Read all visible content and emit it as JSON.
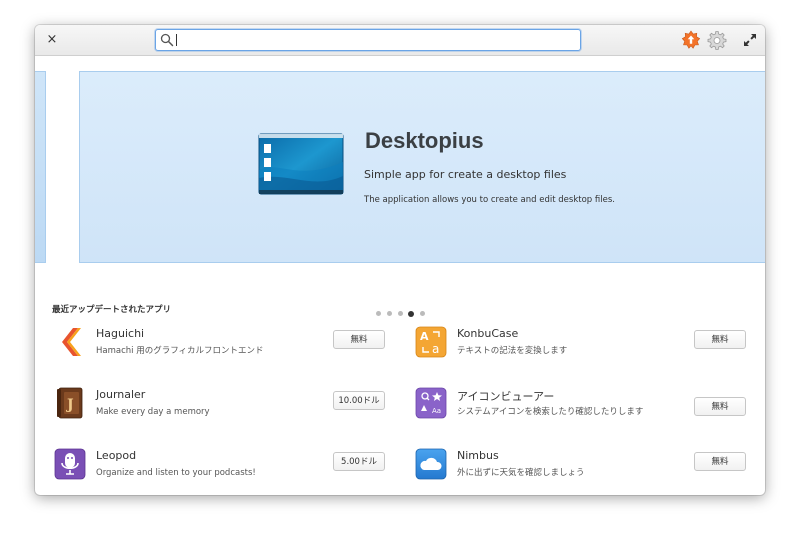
{
  "header": {
    "close_glyph": "×",
    "search_placeholder": "",
    "search_value": ""
  },
  "banner": {
    "title": "Desktopius",
    "summary": "Simple app for create a desktop files",
    "description": "The application allows you to create and edit desktop files.",
    "dots_count": 5,
    "active_dot": 4
  },
  "section": {
    "title": "最近アップデートされたアプリ"
  },
  "apps": [
    {
      "name": "Haguichi",
      "summary": "Hamachi 用のグラフィカルフロントエンド",
      "price": "無料",
      "icon": "haguichi-icon"
    },
    {
      "name": "KonbuCase",
      "summary": "テキストの記法を変換します",
      "price": "無料",
      "icon": "konbucase-icon"
    },
    {
      "name": "Journaler",
      "summary": "Make every day a memory",
      "price": "10.00ドル",
      "icon": "journaler-icon"
    },
    {
      "name": "アイコンビューアー",
      "summary": "システムアイコンを検索したり確認したりします",
      "price": "無料",
      "icon": "icon-viewer-icon"
    },
    {
      "name": "Leopod",
      "summary": "Organize and listen to your podcasts!",
      "price": "5.00ドル",
      "icon": "leopod-icon"
    },
    {
      "name": "Nimbus",
      "summary": "外に出ずに天気を確認しましょう",
      "price": "無料",
      "icon": "nimbus-icon"
    }
  ],
  "colors": {
    "accent": "#6aa4e6",
    "banner_bg": "#d6e9fa",
    "update_badge": "#f37329"
  }
}
